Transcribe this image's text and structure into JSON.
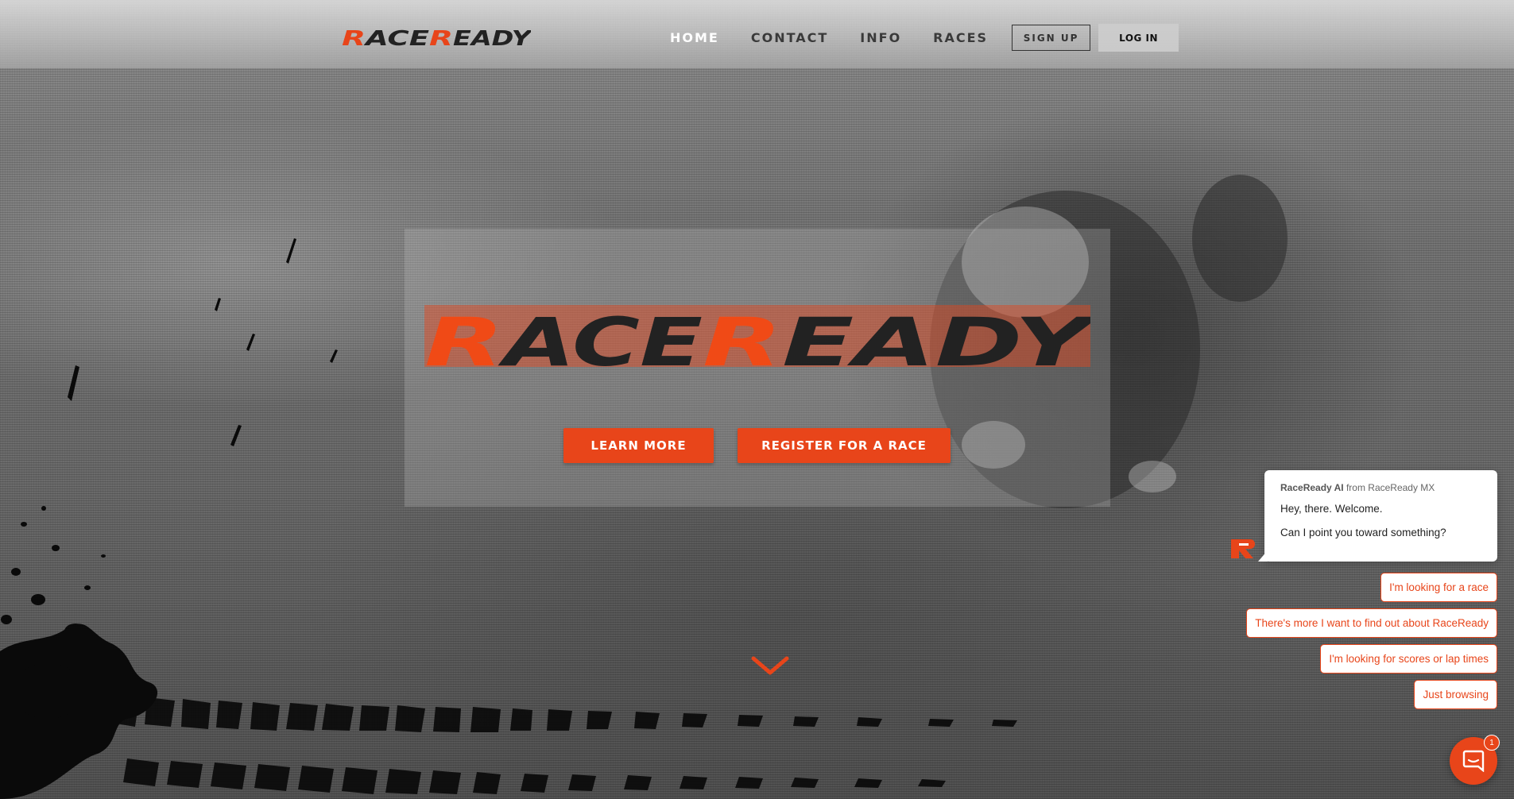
{
  "brand": {
    "name": "RaceReady",
    "colors": {
      "accent": "#e8451a",
      "dark": "#222222",
      "light": "#ffffff"
    }
  },
  "nav": {
    "items": [
      {
        "label": "HOME",
        "active": true
      },
      {
        "label": "CONTACT",
        "active": false
      },
      {
        "label": "INFO",
        "active": false
      },
      {
        "label": "RACES",
        "active": false
      }
    ],
    "signup_label": "SIGN UP",
    "login_label": "LOG IN"
  },
  "hero": {
    "learn_more_label": "LEARN MORE",
    "register_label": "REGISTER FOR A RACE",
    "scroll_icon": "chevron-down-icon"
  },
  "chat": {
    "sender_name": "RaceReady AI",
    "sender_from": "from RaceReady MX",
    "messages": [
      "Hey, there. Welcome.",
      "Can I point you toward something?"
    ],
    "options": [
      "I'm looking for a race",
      "There's more I want to find out about RaceReady",
      "I'm looking for scores or lap times",
      "Just browsing"
    ],
    "unread_count": "1",
    "launcher_icon": "chat-bubble-icon"
  }
}
